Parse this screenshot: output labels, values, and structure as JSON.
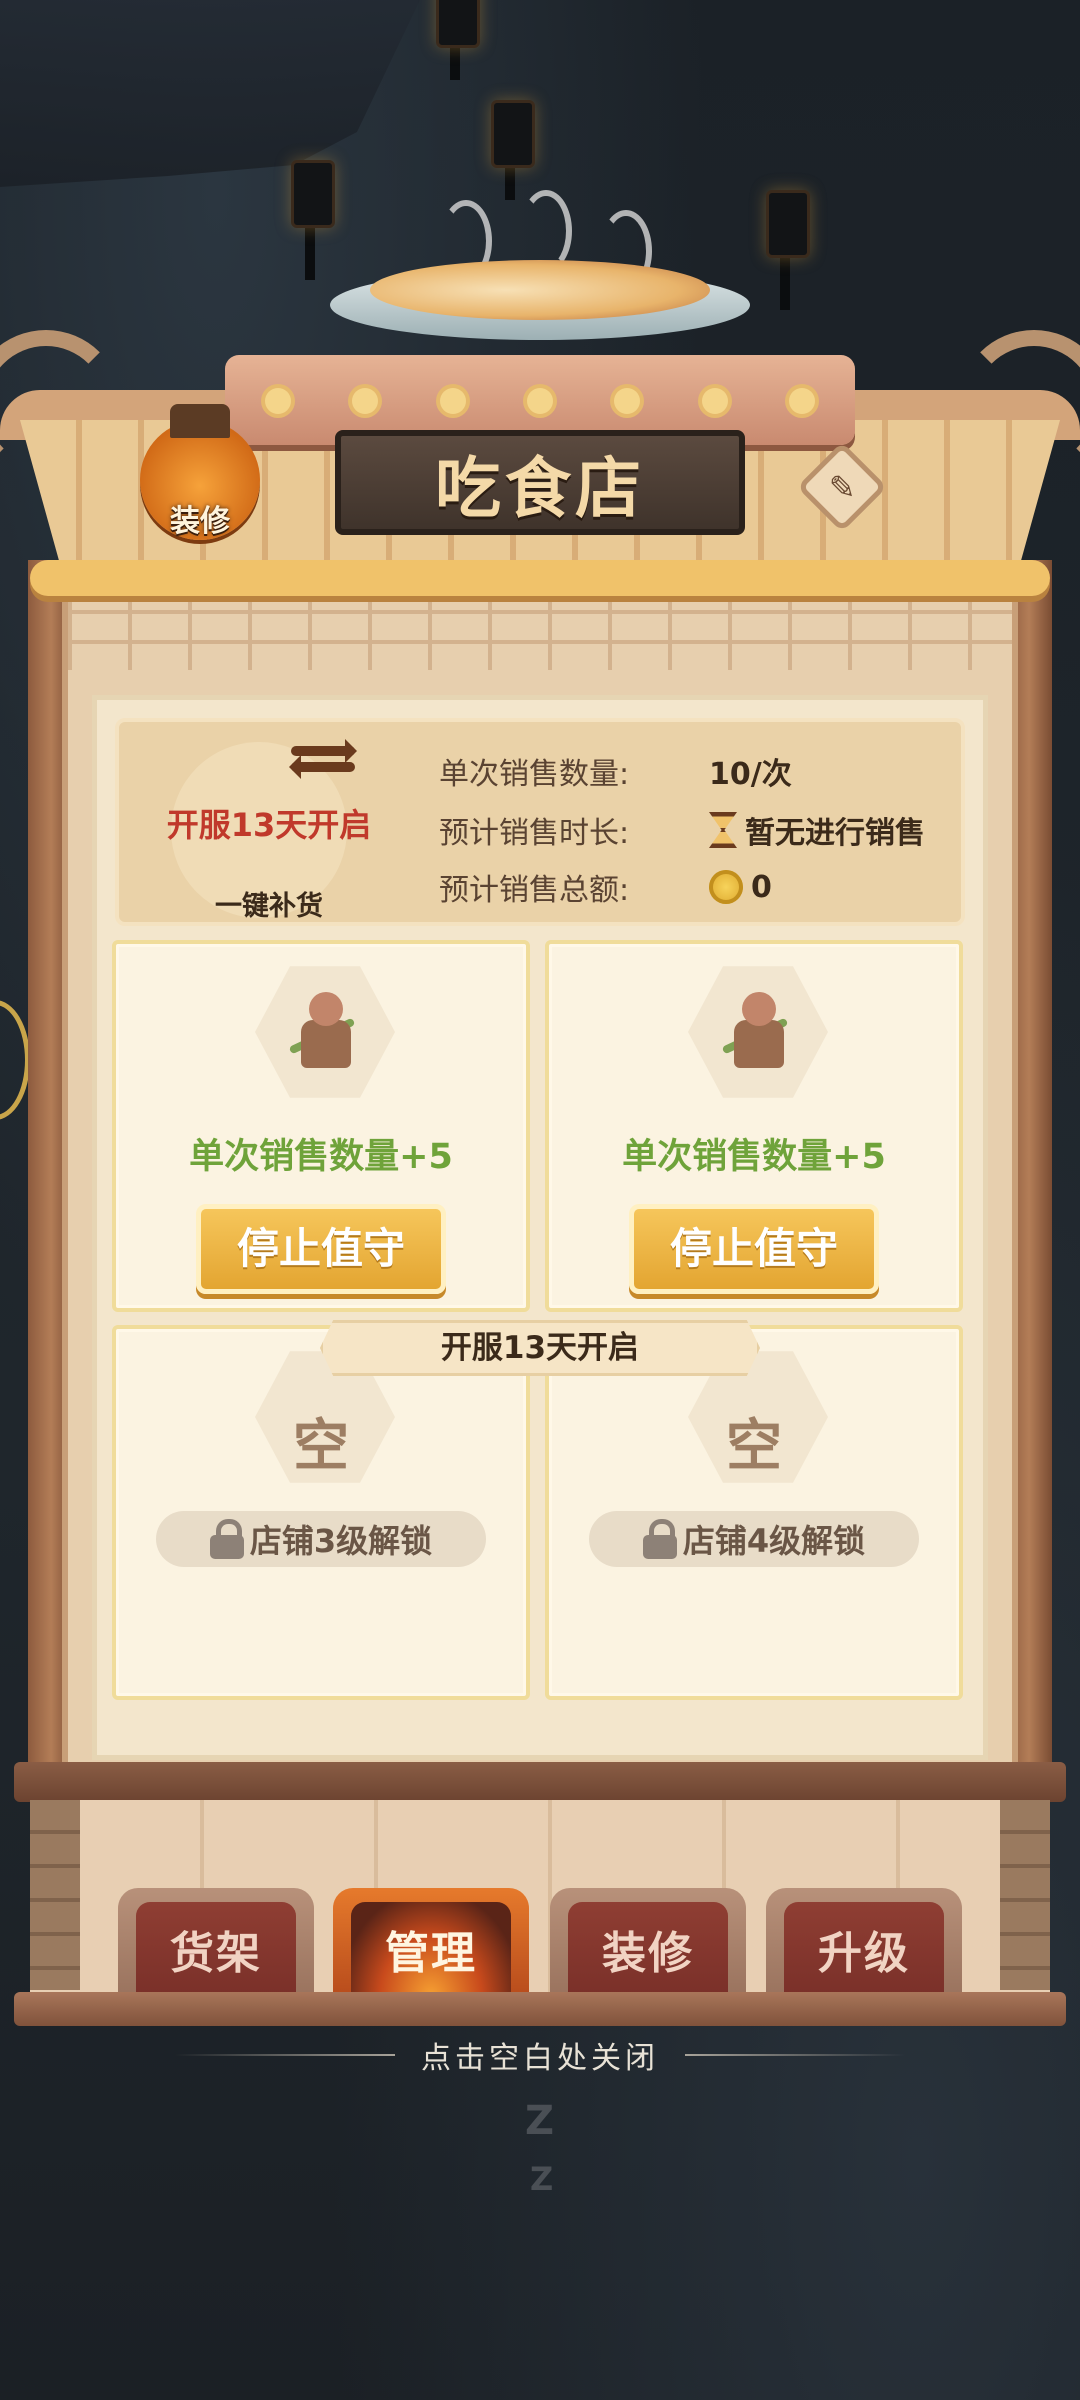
{
  "shop": {
    "title": "吃食店",
    "decorate_button": "装修",
    "edit_icon": "pencil-icon"
  },
  "info": {
    "restock_locked_text": "开服13天开启",
    "restock_label": "一键补货",
    "stats": [
      {
        "label": "单次销售数量:",
        "value": "10/次"
      },
      {
        "label": "预计销售时长:",
        "value": "暂无进行销售"
      },
      {
        "label": "预计销售总额:",
        "value": "0"
      }
    ]
  },
  "slots": [
    {
      "bonus": "单次销售数量+5",
      "button": "停止值守"
    },
    {
      "bonus": "单次销售数量+5",
      "button": "停止值守"
    },
    {
      "empty": "空",
      "lock": "店铺3级解锁"
    },
    {
      "empty": "空",
      "lock": "店铺4级解锁"
    }
  ],
  "locked_row_tag": "开服13天开启",
  "tabs": [
    {
      "label": "货架",
      "active": false
    },
    {
      "label": "管理",
      "active": true
    },
    {
      "label": "装修",
      "active": false
    },
    {
      "label": "升级",
      "active": false
    }
  ],
  "close_hint": "点击空白处关闭",
  "sleep_marks": [
    "Z",
    "Z"
  ],
  "colors": {
    "accent_green": "#6fa33a",
    "locked_red": "#c0392b",
    "gold_button": "#e3a531"
  }
}
